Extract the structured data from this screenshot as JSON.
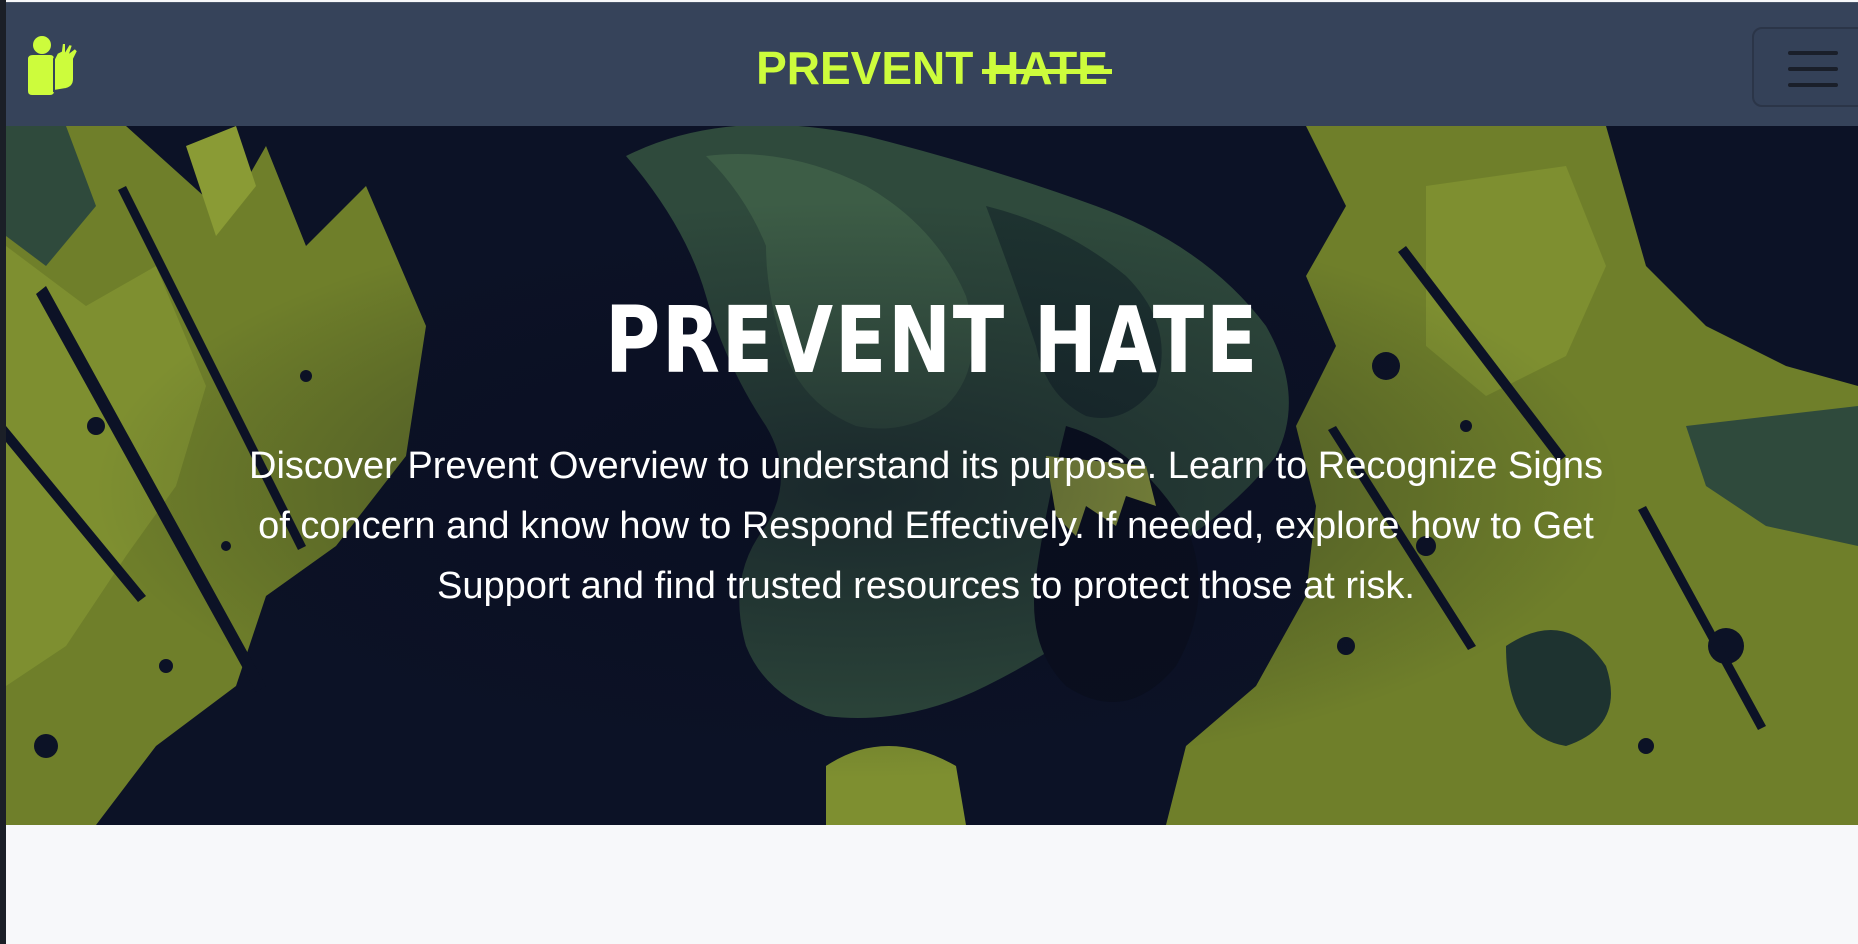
{
  "navbar": {
    "logo_icon": "person-shield-icon",
    "brand_first": "PREVENT",
    "brand_second": "HATE",
    "menu_icon": "hamburger-menu-icon",
    "accent_color": "#cdfc3c",
    "background_color": "#36435a"
  },
  "hero": {
    "title": "PREVENT HATE",
    "description": "Discover Prevent Overview to understand its purpose. Learn to Recognize Signs of concern and know how to Respond Effectively. If needed, explore how to Get Support and find trusted resources to protect those at risk.",
    "background_image": "screaming-face-illustration",
    "palette": [
      "#0c1226",
      "#6f7f2a",
      "#2f4a3c"
    ]
  }
}
